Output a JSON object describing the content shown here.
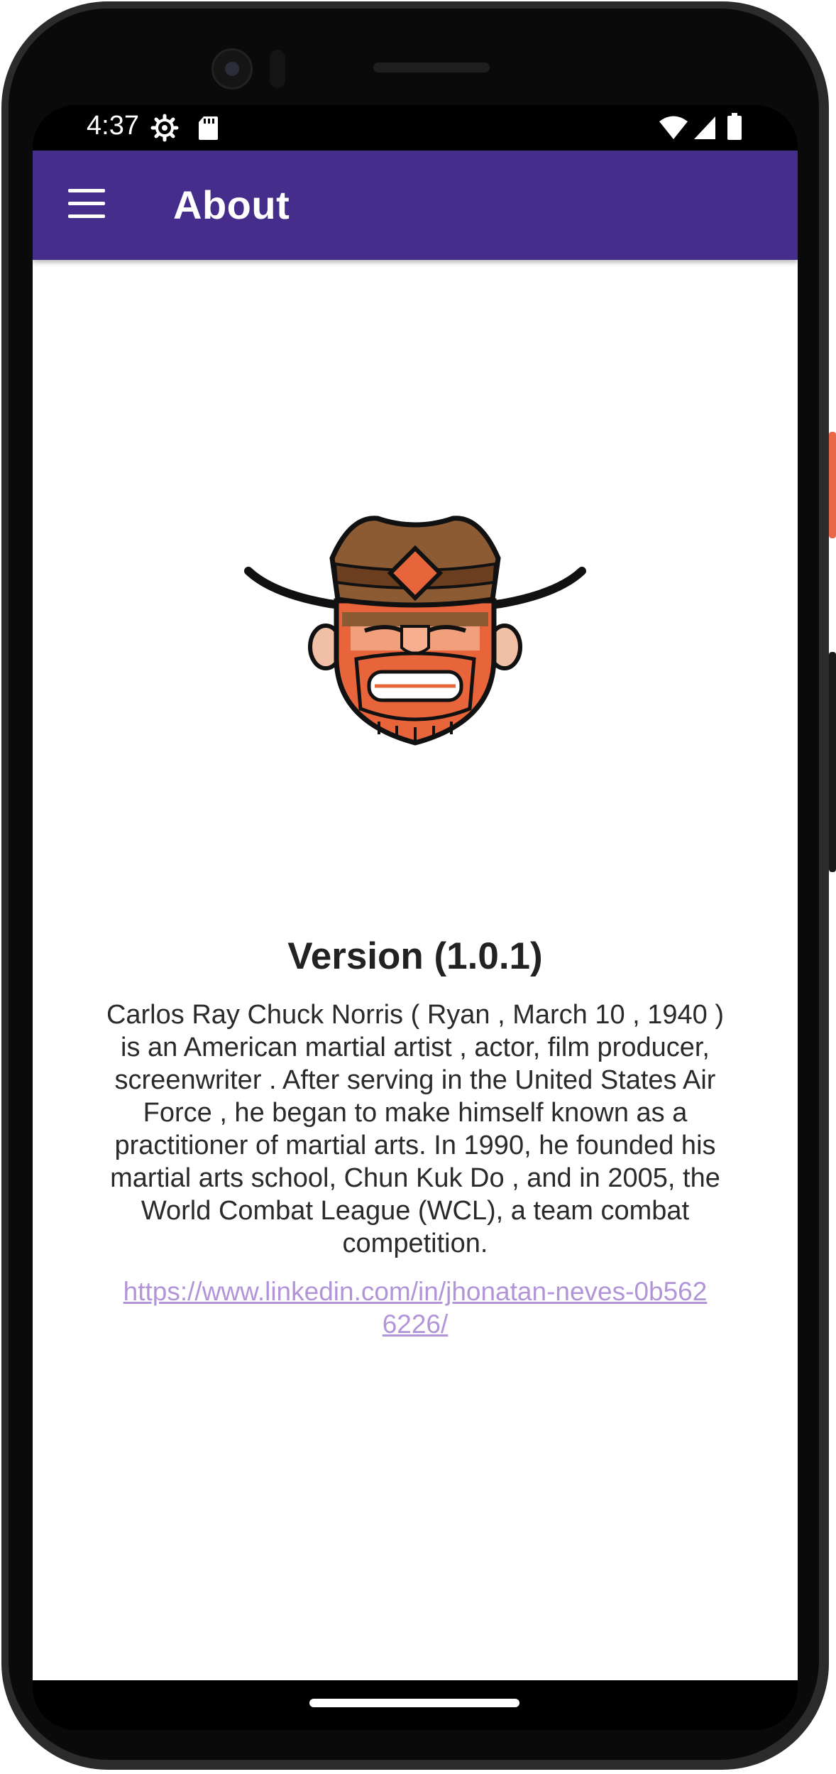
{
  "status_bar": {
    "time": "4:37",
    "icons": [
      "settings-gear-icon",
      "sd-card-icon",
      "wifi-icon",
      "cell-signal-icon",
      "battery-icon"
    ]
  },
  "app_bar": {
    "title": "About",
    "menu_icon": "hamburger-menu-icon",
    "background_color": "#452d8b"
  },
  "about": {
    "logo": "chuck-norris-cowboy-logo",
    "version": "Version (1.0.1)",
    "description": "Carlos Ray Chuck Norris ( Ryan , March 10 , 1940 ) is an American martial artist , actor, film producer, screenwriter . After serving in the United States Air Force , he began to make himself known as a practitioner of martial arts. In 1990, he founded his martial arts school, Chun Kuk Do , and in 2005, the World Combat League (WCL), a team combat competition.",
    "link": "https://www.linkedin.com/in/jhonatan-neves-0b5626226/",
    "link_color": "#b295d8"
  }
}
